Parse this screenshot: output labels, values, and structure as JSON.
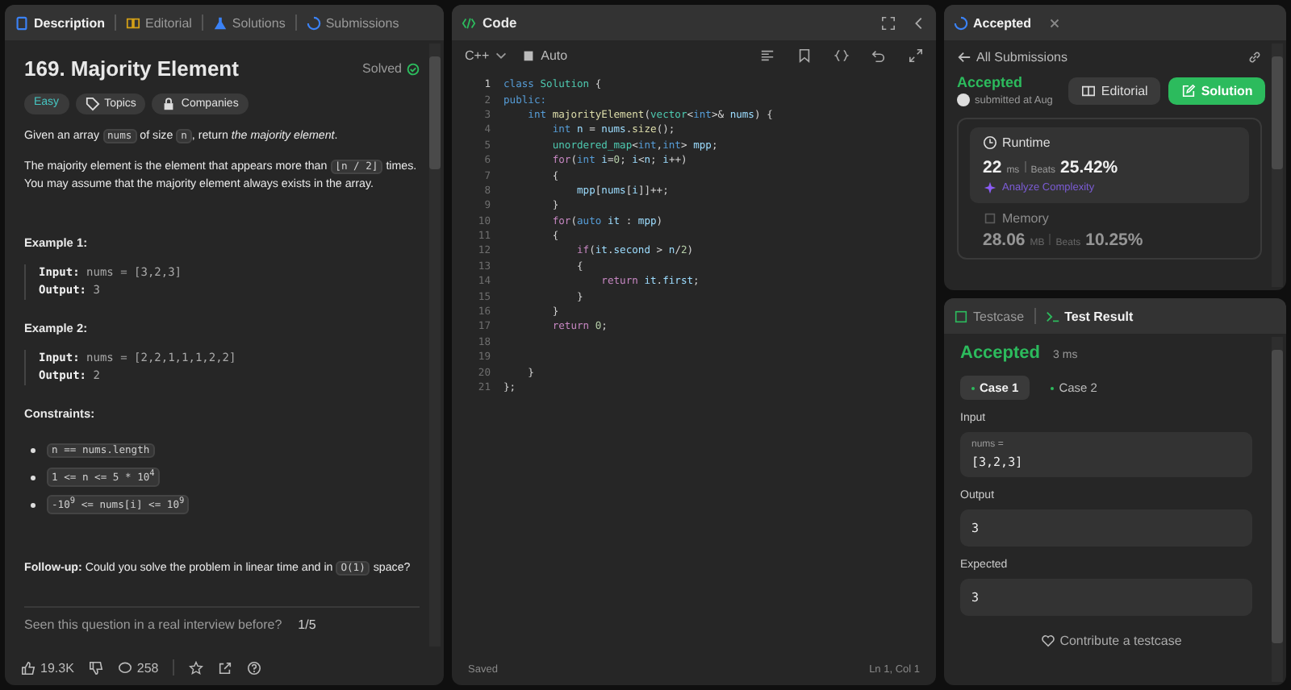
{
  "description_panel": {
    "tabs": [
      {
        "label": "Description",
        "selected": true
      },
      {
        "label": "Editorial",
        "selected": false
      },
      {
        "label": "Solutions",
        "selected": false
      },
      {
        "label": "Submissions",
        "selected": false
      }
    ],
    "title": "169. Majority Element",
    "status": "Solved",
    "difficulty": "Easy",
    "tags": [
      "Topics",
      "Companies"
    ],
    "paragraphs": [
      [
        {
          "kind": "text",
          "text": "Given an array "
        },
        {
          "kind": "code",
          "text": "nums"
        },
        {
          "kind": "text",
          "text": " of size "
        },
        {
          "kind": "code",
          "text": "n"
        },
        {
          "kind": "text",
          "text": ", return *the majority element*."
        }
      ],
      [
        {
          "kind": "text",
          "text": "The majority element is the element that appears more than "
        },
        {
          "kind": "code",
          "text": "⌊n / 2⌋"
        },
        {
          "kind": "text",
          "text": " times. You may assume that the majority element always exists in the array."
        }
      ]
    ],
    "examples": [
      {
        "heading": "Example 1:",
        "input_label": "Input:",
        "input": "nums = [3,2,3]",
        "output_label": "Output:",
        "output": "3"
      },
      {
        "heading": "Example 2:",
        "input_label": "Input:",
        "input": "nums = [2,2,1,1,1,2,2]",
        "output_label": "Output:",
        "output": "2"
      }
    ],
    "constraints_heading": "Constraints:",
    "constraints": [
      "n == nums.length",
      "1 <= n <= 5 * 10$^{4}$",
      "-10$^{9}$ <= nums[i] <= 10$^{9}$"
    ],
    "follow_up": [
      {
        "kind": "text",
        "text": "**Follow-up:** Could you solve the problem in linear time and in "
      },
      {
        "kind": "code",
        "text": "O(1)"
      },
      {
        "kind": "text",
        "text": " space?"
      }
    ],
    "interview_prompt": "Seen this question in a real interview before?",
    "interview_count": "1/5",
    "likes": "19.3K",
    "comments": "258"
  },
  "code_panel": {
    "title": "Code",
    "language": "C++",
    "mode": "Auto",
    "lines": [
      {
        "number": "1",
        "tokens": [
          {
            "kind": "kw",
            "text": "class"
          },
          {
            "kind": "type",
            "text": " Solution"
          },
          {
            "kind": "plain",
            "text": " {"
          }
        ]
      },
      {
        "number": "2",
        "tokens": [
          {
            "kind": "kw",
            "text": "public:"
          }
        ]
      },
      {
        "number": "3",
        "tokens": [
          {
            "kind": "kw",
            "text": "    int"
          },
          {
            "kind": "fn",
            "text": " majorityElement"
          },
          {
            "kind": "plain",
            "text": "("
          },
          {
            "kind": "type",
            "text": "vector"
          },
          {
            "kind": "plain",
            "text": "<"
          },
          {
            "kind": "kw",
            "text": "int"
          },
          {
            "kind": "plain",
            "text": ">& "
          },
          {
            "kind": "var",
            "text": "nums"
          },
          {
            "kind": "plain",
            "text": ") {"
          }
        ]
      },
      {
        "number": "4",
        "tokens": [
          {
            "kind": "kw",
            "text": "        int"
          },
          {
            "kind": "var",
            "text": " n"
          },
          {
            "kind": "plain",
            "text": " = "
          },
          {
            "kind": "var",
            "text": "nums"
          },
          {
            "kind": "plain",
            "text": "."
          },
          {
            "kind": "fn",
            "text": "size"
          },
          {
            "kind": "plain",
            "text": "();"
          }
        ]
      },
      {
        "number": "5",
        "tokens": [
          {
            "kind": "type",
            "text": "        unordered_map"
          },
          {
            "kind": "plain",
            "text": "<"
          },
          {
            "kind": "kw",
            "text": "int"
          },
          {
            "kind": "plain",
            "text": ","
          },
          {
            "kind": "kw",
            "text": "int"
          },
          {
            "kind": "plain",
            "text": "> "
          },
          {
            "kind": "var",
            "text": "mpp"
          },
          {
            "kind": "plain",
            "text": ";"
          }
        ]
      },
      {
        "number": "6",
        "tokens": [
          {
            "kind": "ctrl",
            "text": "        for"
          },
          {
            "kind": "plain",
            "text": "("
          },
          {
            "kind": "kw",
            "text": "int"
          },
          {
            "kind": "var",
            "text": " i"
          },
          {
            "kind": "plain",
            "text": "="
          },
          {
            "kind": "num",
            "text": "0"
          },
          {
            "kind": "plain",
            "text": "; "
          },
          {
            "kind": "var",
            "text": "i"
          },
          {
            "kind": "plain",
            "text": "<"
          },
          {
            "kind": "var",
            "text": "n"
          },
          {
            "kind": "plain",
            "text": "; "
          },
          {
            "kind": "var",
            "text": "i"
          },
          {
            "kind": "plain",
            "text": "++)"
          }
        ]
      },
      {
        "number": "7",
        "tokens": [
          {
            "kind": "plain",
            "text": "        {"
          }
        ]
      },
      {
        "number": "8",
        "tokens": [
          {
            "kind": "var",
            "text": "            mpp"
          },
          {
            "kind": "plain",
            "text": "["
          },
          {
            "kind": "var",
            "text": "nums"
          },
          {
            "kind": "plain",
            "text": "["
          },
          {
            "kind": "var",
            "text": "i"
          },
          {
            "kind": "plain",
            "text": "]]++;"
          }
        ]
      },
      {
        "number": "9",
        "tokens": [
          {
            "kind": "plain",
            "text": "        }"
          }
        ]
      },
      {
        "number": "10",
        "tokens": [
          {
            "kind": "ctrl",
            "text": "        for"
          },
          {
            "kind": "plain",
            "text": "("
          },
          {
            "kind": "kw",
            "text": "auto"
          },
          {
            "kind": "var",
            "text": " it"
          },
          {
            "kind": "plain",
            "text": " : "
          },
          {
            "kind": "var",
            "text": "mpp"
          },
          {
            "kind": "plain",
            "text": ")"
          }
        ]
      },
      {
        "number": "11",
        "tokens": [
          {
            "kind": "plain",
            "text": "        {"
          }
        ]
      },
      {
        "number": "12",
        "tokens": [
          {
            "kind": "ctrl",
            "text": "            if"
          },
          {
            "kind": "plain",
            "text": "("
          },
          {
            "kind": "var",
            "text": "it"
          },
          {
            "kind": "plain",
            "text": "."
          },
          {
            "kind": "var",
            "text": "second"
          },
          {
            "kind": "plain",
            "text": " > "
          },
          {
            "kind": "var",
            "text": "n"
          },
          {
            "kind": "plain",
            "text": "/"
          },
          {
            "kind": "num",
            "text": "2"
          },
          {
            "kind": "plain",
            "text": ")"
          }
        ]
      },
      {
        "number": "13",
        "tokens": [
          {
            "kind": "plain",
            "text": "            {"
          }
        ]
      },
      {
        "number": "14",
        "tokens": [
          {
            "kind": "ctrl",
            "text": "                return"
          },
          {
            "kind": "var",
            "text": " it"
          },
          {
            "kind": "plain",
            "text": "."
          },
          {
            "kind": "var",
            "text": "first"
          },
          {
            "kind": "plain",
            "text": ";"
          }
        ]
      },
      {
        "number": "15",
        "tokens": [
          {
            "kind": "plain",
            "text": "            }"
          }
        ]
      },
      {
        "number": "16",
        "tokens": [
          {
            "kind": "plain",
            "text": "        }"
          }
        ]
      },
      {
        "number": "17",
        "tokens": [
          {
            "kind": "ctrl",
            "text": "        return"
          },
          {
            "kind": "num",
            "text": " 0"
          },
          {
            "kind": "plain",
            "text": ";"
          }
        ]
      },
      {
        "number": "18"
      },
      {
        "number": "19"
      },
      {
        "number": "20",
        "tokens": [
          {
            "kind": "plain",
            "text": "    }"
          }
        ]
      },
      {
        "number": "21",
        "tokens": [
          {
            "kind": "plain",
            "text": "};"
          }
        ]
      }
    ],
    "status": "Saved",
    "cursor": "Ln 1, Col 1"
  },
  "submission_panel": {
    "tab": "Accepted",
    "back": "All Submissions",
    "result": "Accepted",
    "submitted": "submitted at Aug",
    "buttons": [
      {
        "label": "Editorial",
        "kind": "secondary"
      },
      {
        "label": "Solution",
        "kind": "primary"
      }
    ],
    "runtime": {
      "label": "Runtime",
      "value": "22",
      "unit": "ms",
      "beats_label": "Beats",
      "beats": "25.42%",
      "link": "Analyze Complexity"
    },
    "memory": {
      "label": "Memory",
      "value": "28.06",
      "unit": "MB",
      "beats_label": "Beats",
      "beats": "10.25%"
    }
  },
  "result_panel": {
    "tabs": [
      {
        "label": "Testcase",
        "selected": false
      },
      {
        "label": "Test Result",
        "selected": true
      }
    ],
    "verdict": "Accepted",
    "time": "3 ms",
    "cases": [
      {
        "label": "Case 1",
        "selected": true
      },
      {
        "label": "Case 2",
        "selected": false
      }
    ],
    "input_label": "Input",
    "input_name": "nums =",
    "input_value": "[3,2,3]",
    "output_label": "Output",
    "output": "3",
    "expected_label": "Expected",
    "expected": "3",
    "contribute": "Contribute a testcase"
  }
}
